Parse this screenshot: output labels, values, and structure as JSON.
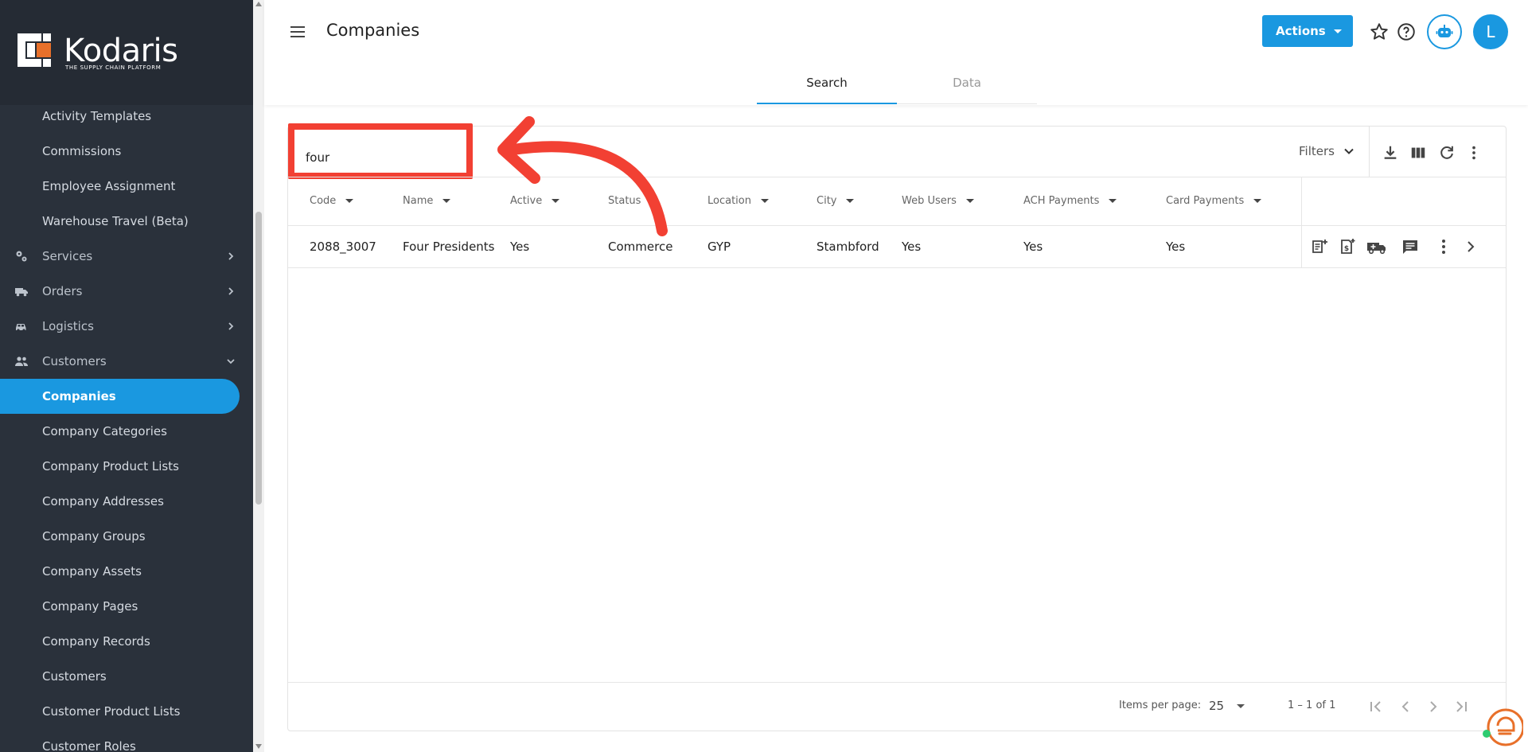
{
  "app": {
    "brand": "Kodaris",
    "tagline": "THE SUPPLY CHAIN PLATFORM",
    "accent_color": "#1a98e0",
    "sidebar_color": "#2a313b",
    "annotation_color": "#f24033"
  },
  "sidebar": {
    "items": [
      {
        "label": "Activity Templates",
        "type": "sub"
      },
      {
        "label": "Commissions",
        "type": "sub"
      },
      {
        "label": "Employee Assignment",
        "type": "sub"
      },
      {
        "label": "Warehouse Travel (Beta)",
        "type": "sub"
      },
      {
        "label": "Services",
        "type": "section",
        "icon": "gears-icon",
        "expanded": false
      },
      {
        "label": "Orders",
        "type": "section",
        "icon": "truck-icon",
        "expanded": false
      },
      {
        "label": "Logistics",
        "type": "section",
        "icon": "car-icon",
        "expanded": false
      },
      {
        "label": "Customers",
        "type": "section",
        "icon": "people-icon",
        "expanded": true
      },
      {
        "label": "Companies",
        "type": "sub",
        "active": true
      },
      {
        "label": "Company Categories",
        "type": "sub"
      },
      {
        "label": "Company Product Lists",
        "type": "sub"
      },
      {
        "label": "Company Addresses",
        "type": "sub"
      },
      {
        "label": "Company Groups",
        "type": "sub"
      },
      {
        "label": "Company Assets",
        "type": "sub"
      },
      {
        "label": "Company Pages",
        "type": "sub"
      },
      {
        "label": "Company Records",
        "type": "sub"
      },
      {
        "label": "Customers",
        "type": "sub"
      },
      {
        "label": "Customer Product Lists",
        "type": "sub"
      },
      {
        "label": "Customer Roles",
        "type": "sub"
      }
    ]
  },
  "header": {
    "title": "Companies",
    "actions_label": "Actions",
    "avatar_initial": "L",
    "tabs": [
      {
        "label": "Search",
        "active": true
      },
      {
        "label": "Data",
        "active": false
      }
    ]
  },
  "search": {
    "value": "four",
    "filters_label": "Filters"
  },
  "table": {
    "columns": [
      "Code",
      "Name",
      "Active",
      "Status",
      "Location",
      "City",
      "Web Users",
      "ACH Payments",
      "Card Payments"
    ],
    "rows": [
      [
        "2088_3007",
        "Four Presidents",
        "Yes",
        "Commerce",
        "GYP",
        "Stambford",
        "Yes",
        "Yes",
        "Yes"
      ]
    ]
  },
  "pagination": {
    "items_per_page_label": "Items per page:",
    "items_per_page": "25",
    "range": "1 – 1 of 1"
  }
}
